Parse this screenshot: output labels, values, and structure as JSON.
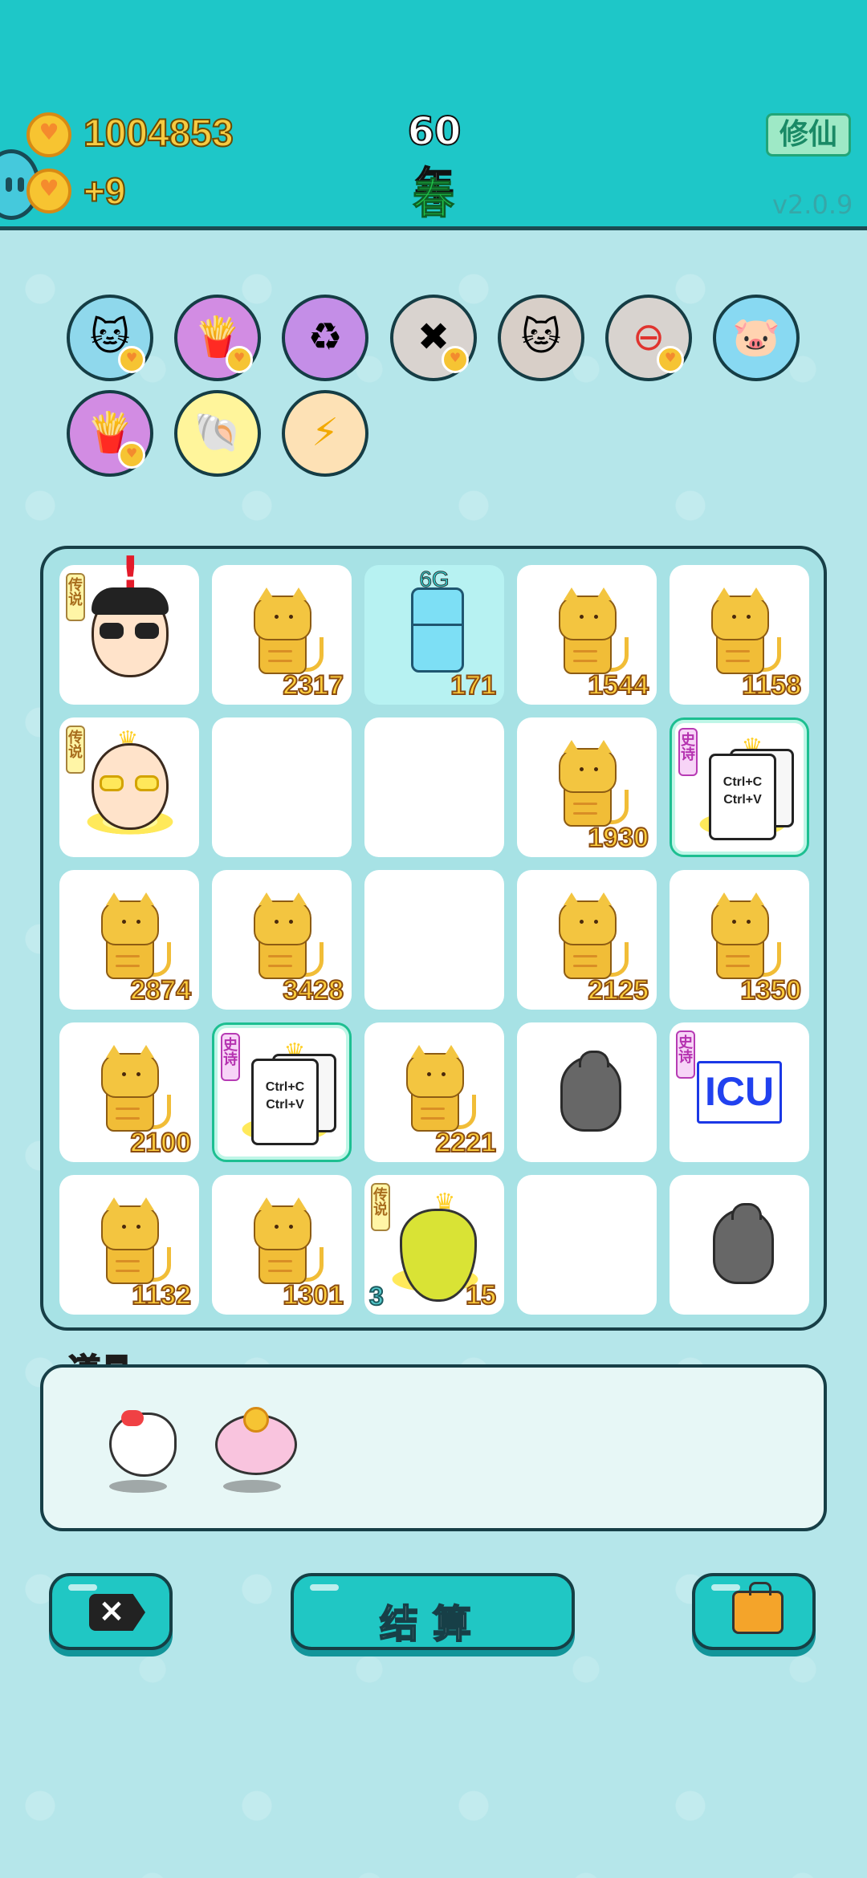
{
  "header": {
    "coins_value": "1004853",
    "coin_rate": "+9",
    "year": "60年",
    "season": "春",
    "mode_button": "修仙",
    "version": "v2.0.9"
  },
  "buffs": [
    {
      "icon": "cat-sunglasses-icon"
    },
    {
      "icon": "fries-icon"
    },
    {
      "icon": "recycle-icon"
    },
    {
      "icon": "delete-tag-icon"
    },
    {
      "icon": "twin-cats-icon"
    },
    {
      "icon": "minus-circle-icon"
    },
    {
      "icon": "piggy-bank-icon"
    },
    {
      "icon": "fries-icon"
    },
    {
      "icon": "shell-icon"
    },
    {
      "icon": "lightning-icon"
    }
  ],
  "board": {
    "cells": [
      {
        "type": "person-boss",
        "label": "传说"
      },
      {
        "type": "cat",
        "value": "2317"
      },
      {
        "type": "fridge",
        "top_label": "6G",
        "value": "171"
      },
      {
        "type": "cat",
        "value": "1544"
      },
      {
        "type": "cat",
        "value": "1158"
      },
      {
        "type": "person-king",
        "label": "传说"
      },
      {
        "type": "empty"
      },
      {
        "type": "empty"
      },
      {
        "type": "cat",
        "value": "1930"
      },
      {
        "type": "ctrl",
        "label": "史诗",
        "line1": "Ctrl+C",
        "line2": "Ctrl+V"
      },
      {
        "type": "cat",
        "value": "2874"
      },
      {
        "type": "cat",
        "value": "3428"
      },
      {
        "type": "empty"
      },
      {
        "type": "cat",
        "value": "2125"
      },
      {
        "type": "cat",
        "value": "1350"
      },
      {
        "type": "cat",
        "value": "2100"
      },
      {
        "type": "ctrl",
        "label": "史诗",
        "line1": "Ctrl+C",
        "line2": "Ctrl+V"
      },
      {
        "type": "cat",
        "value": "2221"
      },
      {
        "type": "trash"
      },
      {
        "type": "icu",
        "label": "史诗",
        "text": "ICU"
      },
      {
        "type": "cat",
        "value": "1132"
      },
      {
        "type": "cat",
        "value": "1301"
      },
      {
        "type": "blob",
        "label": "传说",
        "left_value": "3",
        "value": "15"
      },
      {
        "type": "empty"
      },
      {
        "type": "trash"
      }
    ]
  },
  "items": {
    "title": "道具",
    "list": [
      {
        "icon": "dove-icon"
      },
      {
        "icon": "piggy-bank-icon"
      }
    ]
  },
  "footer": {
    "settle_label": "结算"
  }
}
